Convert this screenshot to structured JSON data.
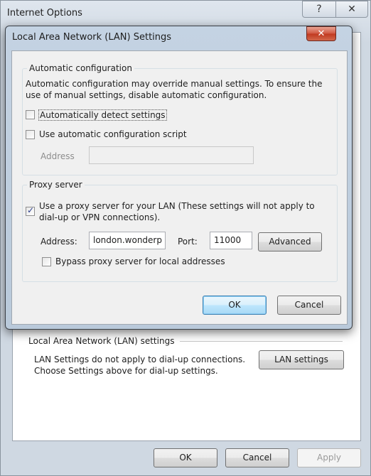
{
  "outer": {
    "title": "Internet Options",
    "help": "?",
    "close": "✕",
    "lan_group": {
      "label": "Local Area Network (LAN) settings",
      "text1": "LAN Settings do not apply to dial-up connections.",
      "text2": "Choose Settings above for dial-up settings.",
      "button": "LAN settings"
    },
    "buttons": {
      "ok": "OK",
      "cancel": "Cancel",
      "apply": "Apply"
    }
  },
  "dialog": {
    "title": "Local Area Network (LAN) Settings",
    "close": "✕",
    "auto": {
      "label": "Automatic configuration",
      "desc1": "Automatic configuration may override manual settings.  To ensure the",
      "desc2": "use of manual settings, disable automatic configuration.",
      "detect": {
        "label": "Automatically detect settings",
        "checked": false
      },
      "script": {
        "label": "Use automatic configuration script",
        "checked": false
      },
      "address_label": "Address",
      "address_value": ""
    },
    "proxy": {
      "label": "Proxy server",
      "use": {
        "label1": "Use a proxy server for your LAN (These settings will not apply to",
        "label2": "dial-up or VPN connections).",
        "checked": true
      },
      "address_label": "Address:",
      "address_value": "london.wonderp",
      "port_label": "Port:",
      "port_value": "11000",
      "advanced": "Advanced",
      "bypass": {
        "label": "Bypass proxy server for local addresses",
        "checked": false
      }
    },
    "ok": "OK",
    "cancel": "Cancel"
  }
}
